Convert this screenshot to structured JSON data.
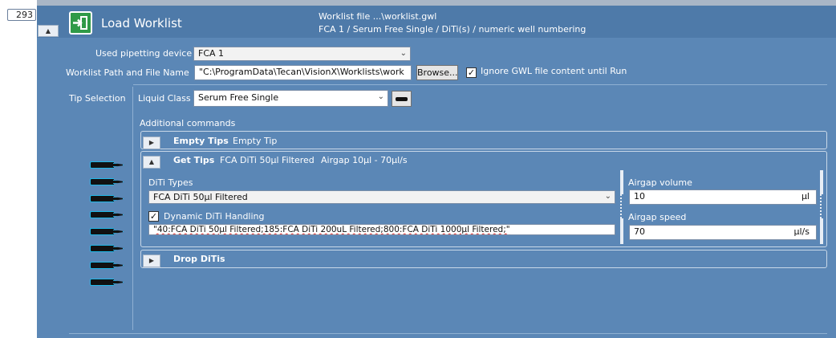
{
  "line_number": "293",
  "header": {
    "title": "Load Worklist",
    "worklist_file": "Worklist file ...\\worklist.gwl",
    "summary": "FCA 1 / Serum Free Single / DiTi(s) / numeric well numbering"
  },
  "device": {
    "label": "Used pipetting device",
    "value": "FCA 1"
  },
  "path": {
    "label": "Worklist Path and File Name",
    "value": "\"C:\\ProgramData\\Tecan\\VisionX\\Worklists\\work",
    "browse_label": "Browse...",
    "ignore_label": "Ignore GWL file content until Run",
    "ignore_checked": true
  },
  "tip_selection": {
    "label": "Tip Selection",
    "liquid_class_label": "Liquid Class",
    "liquid_class_value": "Serum Free Single"
  },
  "additional": {
    "label": "Additional commands",
    "empty_tips": {
      "title": "Empty Tips",
      "detail": "Empty Tip"
    },
    "get_tips": {
      "title": "Get Tips",
      "detail1": "FCA DiTi 50µl Filtered",
      "detail2": "Airgap 10µl - 70µl/s",
      "diti_types_label": "DiTi Types",
      "diti_types_value": "FCA DiTi 50µl Filtered",
      "dynamic_label": "Dynamic DiTi Handling",
      "dynamic_checked": true,
      "dynamic_value": "\"40:FCA DiTi 50µl Filtered;185:FCA DiTi 200uL Filtered;800:FCA DiTi 1000µl Filtered;\"",
      "airgap_volume_label": "Airgap volume",
      "airgap_volume_value": "10",
      "airgap_volume_unit": "µl",
      "airgap_speed_label": "Airgap speed",
      "airgap_speed_value": "70",
      "airgap_speed_unit": "µl/s"
    },
    "drop_ditis": {
      "title": "Drop DiTis"
    }
  },
  "colors": {
    "background": "#5b87b6",
    "header": "#4e7aa9",
    "app_icon": "#2f9a47",
    "tip_outline": "#1fb8e8"
  },
  "icons": [
    "load-worklist-icon",
    "collapse-arrow-icon",
    "expand-arrow-icon",
    "chevron-down-icon",
    "checkbox-checked-icon",
    "liquid-class-icon",
    "pipette-tip-icon"
  ]
}
